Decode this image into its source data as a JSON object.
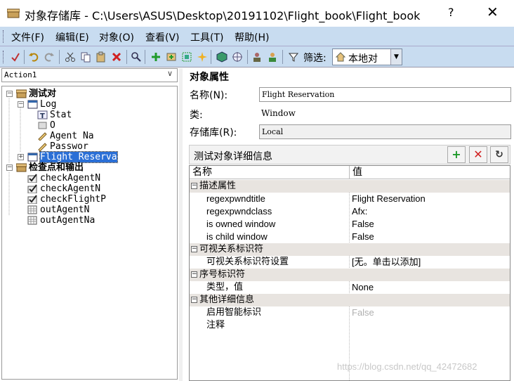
{
  "window": {
    "title": "对象存储库 - C:\\Users\\ASUS\\Desktop\\20191102\\Flight_book\\Flight_book",
    "help": "?",
    "close": "✕"
  },
  "menu": [
    "文件(F)",
    "编辑(E)",
    "对象(O)",
    "查看(V)",
    "工具(T)",
    "帮助(H)"
  ],
  "toolbar": {
    "filter_label": "筛选:",
    "filter_value": "本地对"
  },
  "action_select": "Action1",
  "tree": [
    {
      "label": "测试对",
      "level": 0,
      "bold": true,
      "expander": "−",
      "icon": "repository-icon"
    },
    {
      "label": "Log",
      "level": 1,
      "expander": "−",
      "icon": "window-icon"
    },
    {
      "label": "Stat",
      "level": 2,
      "icon": "static-text-icon"
    },
    {
      "label": "O",
      "level": 2,
      "icon": "button-icon"
    },
    {
      "label": "Agent Na",
      "level": 2,
      "icon": "edit-field-icon"
    },
    {
      "label": "Passwor",
      "level": 2,
      "icon": "edit-field-icon"
    },
    {
      "label": "Flight Reserva",
      "level": 1,
      "expander": "+",
      "icon": "window-icon",
      "selected": true
    },
    {
      "label": "检查点和输出",
      "level": 0,
      "bold": true,
      "expander": "−",
      "icon": "repository-icon"
    },
    {
      "label": "checkAgentN",
      "level": 1,
      "icon": "checkpoint-icon"
    },
    {
      "label": "checkAgentN",
      "level": 1,
      "icon": "checkpoint-icon"
    },
    {
      "label": "checkFlightP",
      "level": 1,
      "icon": "checkpoint-icon"
    },
    {
      "label": "outAgentN",
      "level": 1,
      "icon": "output-icon"
    },
    {
      "label": "outAgentNa",
      "level": 1,
      "icon": "output-icon"
    }
  ],
  "props": {
    "title": "对象属性",
    "name_label": "名称(N):",
    "name_value": "Flight Reservation",
    "class_label": "类:",
    "class_value": "Window",
    "repo_label": "存储库(R):",
    "repo_value": "Local"
  },
  "details": {
    "title": "测试对象详细信息",
    "col_name": "名称",
    "col_value": "值",
    "rows": [
      {
        "type": "cat",
        "name": "描述属性"
      },
      {
        "type": "prop",
        "name": "regexpwndtitle",
        "value": "Flight Reservation"
      },
      {
        "type": "prop",
        "name": "regexpwndclass",
        "value": "Afx:"
      },
      {
        "type": "prop",
        "name": "is owned window",
        "value": "False"
      },
      {
        "type": "prop",
        "name": "is child window",
        "value": "False"
      },
      {
        "type": "cat",
        "name": "可视关系标识符"
      },
      {
        "type": "prop",
        "name": "可视关系标识符设置",
        "value": "[无。单击以添加]"
      },
      {
        "type": "cat",
        "name": "序号标识符"
      },
      {
        "type": "prop",
        "name": "类型，值",
        "value": "None"
      },
      {
        "type": "cat",
        "name": "其他详细信息"
      },
      {
        "type": "prop",
        "name": "启用智能标识",
        "value": "False",
        "disabled": true
      },
      {
        "type": "prop",
        "name": "注释",
        "value": ""
      }
    ]
  },
  "watermark": "https://blog.csdn.net/qq_42472682",
  "colors": {
    "menubar": "#c8dcf0",
    "selection": "#2a6fd6",
    "category_row": "#e8e4e0",
    "add_green": "#1f9a2a",
    "delete_red": "#d02020"
  }
}
